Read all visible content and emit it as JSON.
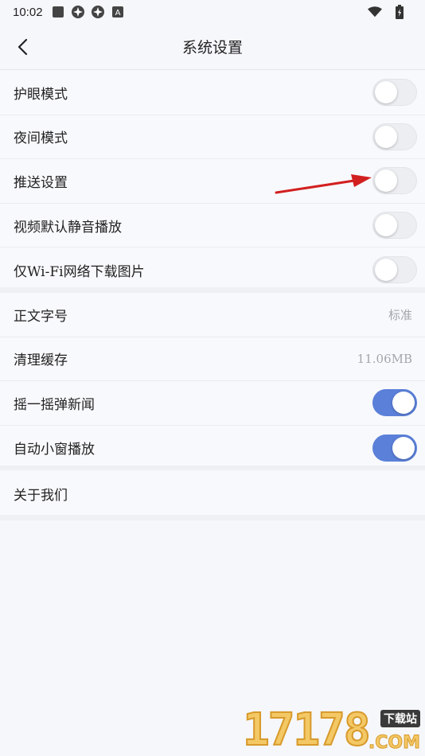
{
  "status_bar": {
    "time": "10:02",
    "icons": [
      "square-icon",
      "pinwheel-icon",
      "pinwheel-icon",
      "a-badge-icon",
      "wifi-icon",
      "battery-icon"
    ]
  },
  "nav": {
    "title": "系统设置",
    "back_icon": "chevron-left-icon"
  },
  "settings_group_1": [
    {
      "label": "护眼模式",
      "toggle": false
    },
    {
      "label": "夜间模式",
      "toggle": false
    },
    {
      "label": "推送设置",
      "toggle": false
    },
    {
      "label": "视频默认静音播放",
      "toggle": false
    },
    {
      "label": "仅Wi-Fi网络下载图片",
      "toggle": false
    }
  ],
  "settings_group_2": [
    {
      "label": "正文字号",
      "value": "标准"
    },
    {
      "label": "清理缓存",
      "value": "11.06MB"
    },
    {
      "label": "摇一摇弹新闻",
      "toggle": true
    },
    {
      "label": "自动小窗播放",
      "toggle": true
    }
  ],
  "settings_group_3": [
    {
      "label": "关于我们"
    }
  ],
  "watermark": {
    "digits": "17178",
    "tag": "下载站",
    "suffix": ".COM"
  },
  "colors": {
    "toggle_on": "#5b80d9",
    "toggle_off": "#eceef2",
    "arrow": "#d21f1f",
    "background": "#f6f7fb"
  }
}
